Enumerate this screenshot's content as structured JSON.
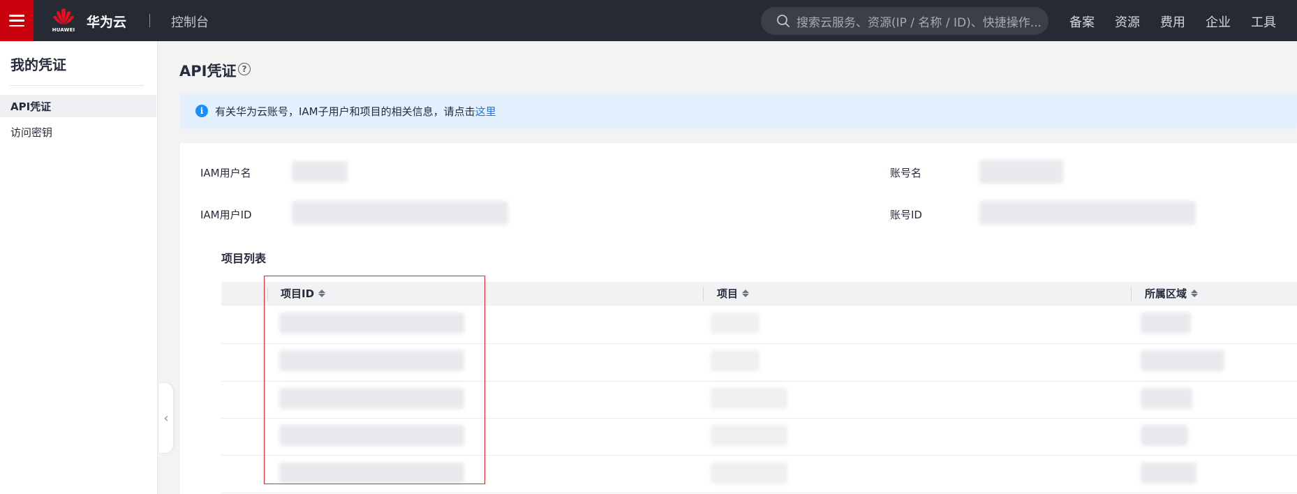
{
  "header": {
    "logo_text": "HUAWEI",
    "brand": "华为云",
    "console_label": "控制台",
    "search_placeholder": "搜索云服务、资源(IP / 名称 / ID)、快捷操作...",
    "nav": [
      "备案",
      "资源",
      "费用",
      "企业",
      "工具"
    ]
  },
  "sidebar": {
    "title": "我的凭证",
    "items": [
      {
        "label": "API凭证",
        "active": true
      },
      {
        "label": "访问密钥",
        "active": false
      }
    ],
    "collapse_glyph": "‹"
  },
  "main": {
    "title": "API凭证",
    "help_glyph": "?",
    "info": {
      "text": "有关华为云账号，IAM子用户和项目的相关信息，请点击",
      "link": "这里"
    },
    "fields": {
      "iam_user_name_label": "IAM用户名",
      "iam_user_id_label": "IAM用户ID",
      "account_name_label": "账号名",
      "account_id_label": "账号ID"
    },
    "project_list": {
      "title": "项目列表",
      "columns": [
        "项目ID",
        "项目",
        "所属区域"
      ],
      "row_count": 5
    }
  },
  "colors": {
    "topbar": "#262a33",
    "brand_red": "#c7000b",
    "link_blue": "#1476ff",
    "info_bg": "#e4f0fd",
    "highlight_red": "#e32c2c"
  }
}
